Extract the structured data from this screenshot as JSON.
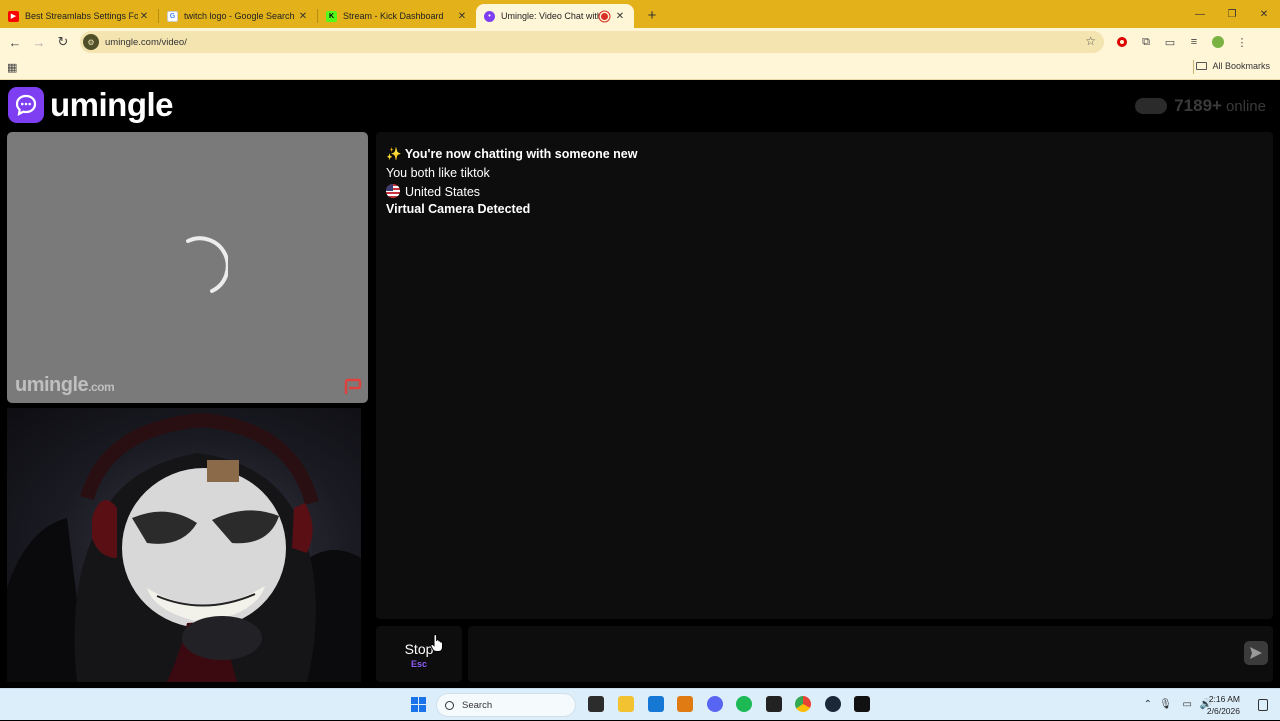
{
  "browser": {
    "tabs": [
      {
        "title": "Best Streamlabs Settings For Lo",
        "favicon": "youtube-icon",
        "color": "#ff0000"
      },
      {
        "title": "twitch logo - Google Search",
        "favicon": "google-icon",
        "color": "#4285f4"
      },
      {
        "title": "Stream - Kick Dashboard",
        "favicon": "kick-icon",
        "color": "#53fc18"
      },
      {
        "title": "Umingle: Video Chat with S",
        "favicon": "umingle-icon",
        "color": "#7e3ff2"
      }
    ],
    "url": "umingle.com/video/",
    "bookmarks_label": "All Bookmarks"
  },
  "page": {
    "logo_text": "umingle",
    "online_count": "7189+",
    "online_label": "online",
    "watermark": "umingle",
    "watermark_suffix": ".com",
    "chat": {
      "messages": [
        {
          "text": "You're now chatting with someone new",
          "icon": "sparkles-icon",
          "bold": true
        },
        {
          "text": "You both like tiktok",
          "bold": false
        },
        {
          "text": "United States",
          "icon": "us-flag-icon",
          "bold": false
        },
        {
          "text": "Virtual Camera Detected",
          "bold": true
        }
      ],
      "input_placeholder": ""
    },
    "stop_button": {
      "label": "Stop",
      "shortcut": "Esc"
    },
    "accent": "#8b5cf6"
  },
  "taskbar": {
    "search_placeholder": "Search",
    "time": "2:16 AM",
    "date": "2/6/2026"
  }
}
